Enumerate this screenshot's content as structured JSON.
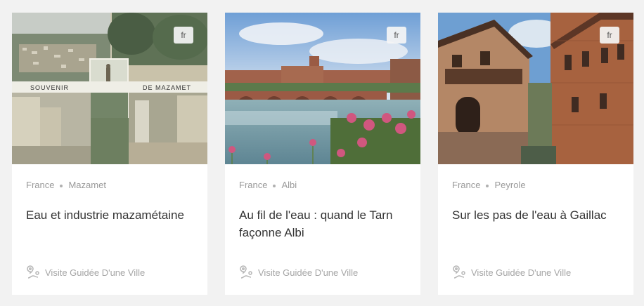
{
  "cards": [
    {
      "lang": "fr",
      "country": "France",
      "city": "Mazamet",
      "title": "Eau et industrie mazamétaine",
      "type_label": "Visite Guidée D'une Ville",
      "type_icon": "map-route-icon",
      "postcard_left_text": "SOUVENIR",
      "postcard_right_text": "DE MAZAMET"
    },
    {
      "lang": "fr",
      "country": "France",
      "city": "Albi",
      "title": "Au fil de l'eau : quand le Tarn façonne Albi",
      "type_label": "Visite Guidée D'une Ville",
      "type_icon": "map-route-icon"
    },
    {
      "lang": "fr",
      "country": "France",
      "city": "Peyrole",
      "title": "Sur les pas de l'eau à Gaillac",
      "type_label": "Visite Guidée D'une Ville",
      "type_icon": "map-route-icon"
    }
  ]
}
